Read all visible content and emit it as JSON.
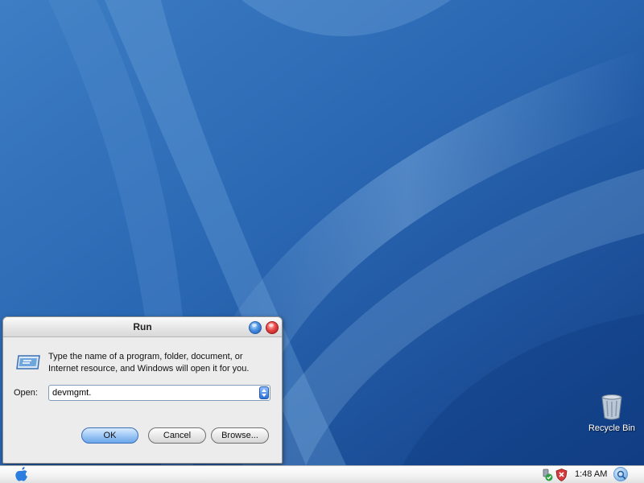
{
  "desktop": {
    "icons": [
      {
        "label": "Recycle Bin",
        "icon": "recycle-bin-icon"
      }
    ]
  },
  "run_dialog": {
    "title": "Run",
    "description": "Type the name of a program, folder, document, or Internet resource, and Windows will open it for you.",
    "open_label": "Open:",
    "open_value": "devmgmt.",
    "buttons": {
      "ok": "OK",
      "cancel": "Cancel",
      "browse": "Browse..."
    }
  },
  "taskbar": {
    "start_icon": "apple-logo-icon",
    "tray": {
      "clock": "1:48 AM",
      "icons": [
        "network-icon",
        "security-shield-icon",
        "search-icon"
      ]
    }
  },
  "colors": {
    "desktop_background": "#1f5aa6",
    "dialog_background": "#ececec",
    "close_button": "#e64646",
    "help_button": "#4a90e2"
  }
}
